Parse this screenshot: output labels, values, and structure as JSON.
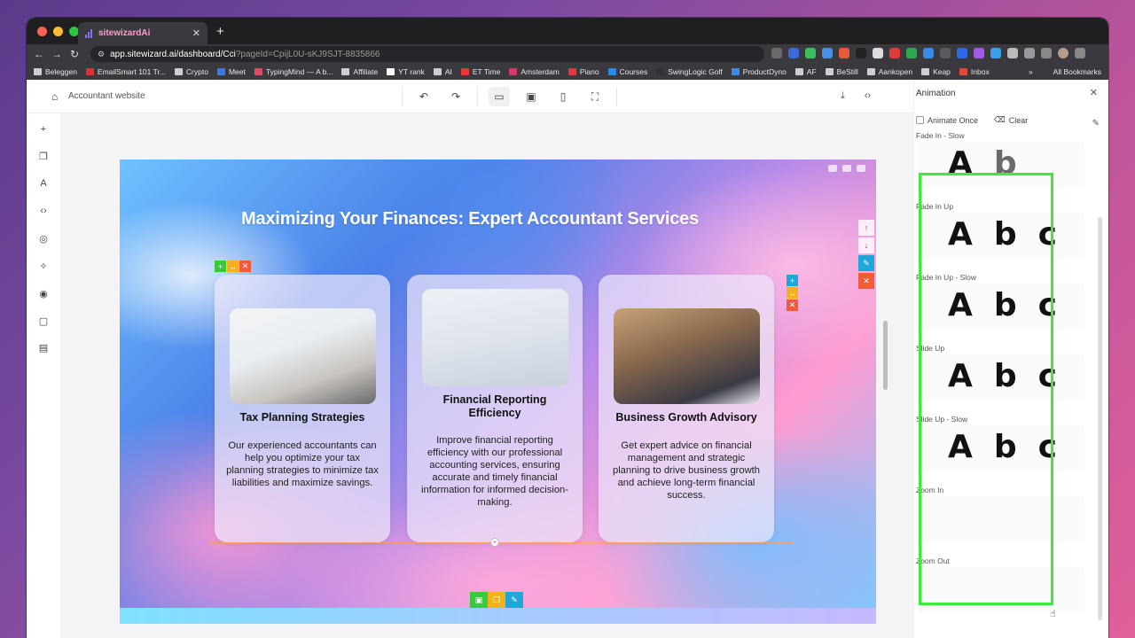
{
  "browser": {
    "tab_title": "sitewizardAi",
    "url_main": "app.sitewizard.ai/dashboard/Cci",
    "url_rest": "?pageId=CpijL0U-sKJ9SJT-8835866",
    "bookmarks": [
      "Beleggen",
      "EmailSmart 101 Tr...",
      "Crypto",
      "Meet",
      "TypingMind — A b...",
      "Affiliate",
      "YT rank",
      "AI",
      "ET Time",
      "Amsterdam",
      "Piano",
      "Courses",
      "SwingLogic Golf",
      "ProductDyno",
      "AF",
      "BeStill",
      "Aankopen",
      "Keap",
      "Inbox"
    ],
    "all_bookmarks": "All Bookmarks"
  },
  "editor": {
    "site_name": "Accountant website"
  },
  "hero": {
    "title": "Maximizing Your Finances: Expert Accountant Services"
  },
  "cards": [
    {
      "title": "Tax Planning Strategies",
      "body": "Our experienced accountants can help you optimize your tax planning strategies to minimize tax liabilities and maximize savings."
    },
    {
      "title": "Financial Reporting Efficiency",
      "body": "Improve financial reporting efficiency with our professional accounting services, ensuring accurate and timely financial information for informed decision-making."
    },
    {
      "title": "Business Growth Advisory",
      "body": "Get expert advice on financial management and strategic planning to drive business growth and achieve long-term financial success."
    }
  ],
  "panel": {
    "title": "Animation",
    "animate_once": "Animate Once",
    "clear": "Clear",
    "animations": [
      {
        "label": "Fade In - Slow",
        "glyphs": [
          "A",
          "b"
        ]
      },
      {
        "label": "Fade In Up",
        "glyphs": [
          "A",
          "b",
          "c"
        ]
      },
      {
        "label": "Fade In Up - Slow",
        "glyphs": [
          "A",
          "b",
          "c"
        ]
      },
      {
        "label": "Slide Up",
        "glyphs": [
          "A",
          "b",
          "c"
        ]
      },
      {
        "label": "Slide Up - Slow",
        "glyphs": [
          "A",
          "b",
          "c"
        ]
      },
      {
        "label": "Zoom In",
        "glyphs": []
      },
      {
        "label": "Zoom Out",
        "glyphs": []
      }
    ]
  },
  "colors": {
    "highlight": "#3ee83e",
    "ctrl_green": "#3cc83c",
    "ctrl_yellow": "#f2b21e",
    "ctrl_red": "#f15a3a",
    "ctrl_blue": "#1ea7d8"
  }
}
